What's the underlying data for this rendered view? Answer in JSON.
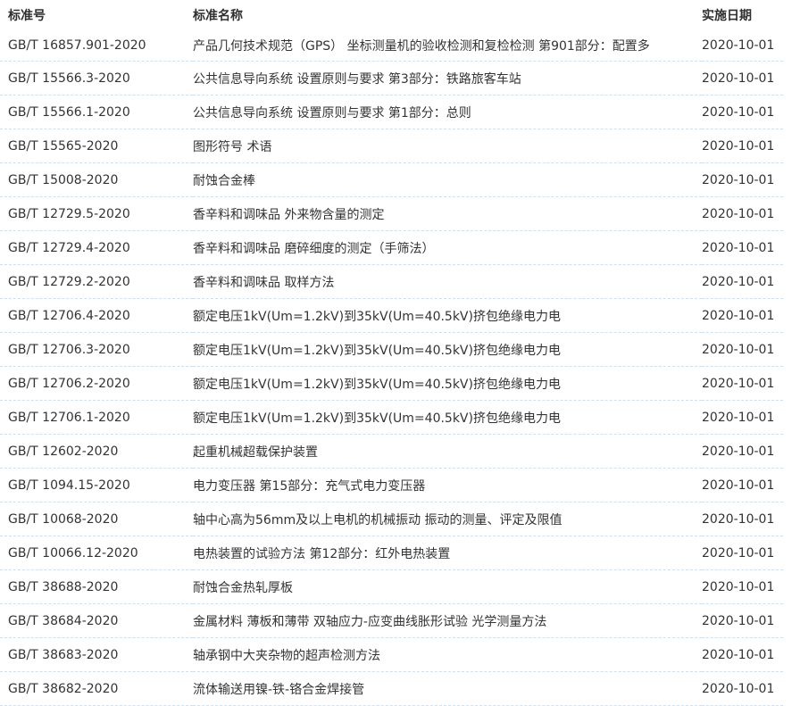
{
  "table": {
    "headers": {
      "code": "标准号",
      "name": "标准名称",
      "date": "实施日期"
    },
    "rows": [
      {
        "code": "GB/T 16857.901-2020",
        "name": "产品几何技术规范（GPS） 坐标测量机的验收检测和复检检测 第901部分：配置多",
        "date": "2020-10-01"
      },
      {
        "code": "GB/T 15566.3-2020",
        "name": "公共信息导向系统 设置原则与要求 第3部分：铁路旅客车站",
        "date": "2020-10-01"
      },
      {
        "code": "GB/T 15566.1-2020",
        "name": "公共信息导向系统 设置原则与要求 第1部分：总则",
        "date": "2020-10-01"
      },
      {
        "code": "GB/T 15565-2020",
        "name": "图形符号 术语",
        "date": "2020-10-01"
      },
      {
        "code": "GB/T 15008-2020",
        "name": "耐蚀合金棒",
        "date": "2020-10-01"
      },
      {
        "code": "GB/T 12729.5-2020",
        "name": "香辛料和调味品 外来物含量的测定",
        "date": "2020-10-01"
      },
      {
        "code": "GB/T 12729.4-2020",
        "name": "香辛料和调味品 磨碎细度的测定（手筛法）",
        "date": "2020-10-01"
      },
      {
        "code": "GB/T 12729.2-2020",
        "name": "香辛料和调味品 取样方法",
        "date": "2020-10-01"
      },
      {
        "code": "GB/T 12706.4-2020",
        "name": "额定电压1kV(Um=1.2kV)到35kV(Um=40.5kV)挤包绝缘电力电",
        "date": "2020-10-01"
      },
      {
        "code": "GB/T 12706.3-2020",
        "name": "额定电压1kV(Um=1.2kV)到35kV(Um=40.5kV)挤包绝缘电力电",
        "date": "2020-10-01"
      },
      {
        "code": "GB/T 12706.2-2020",
        "name": "额定电压1kV(Um=1.2kV)到35kV(Um=40.5kV)挤包绝缘电力电",
        "date": "2020-10-01"
      },
      {
        "code": "GB/T 12706.1-2020",
        "name": "额定电压1kV(Um=1.2kV)到35kV(Um=40.5kV)挤包绝缘电力电",
        "date": "2020-10-01"
      },
      {
        "code": "GB/T 12602-2020",
        "name": "起重机械超载保护装置",
        "date": "2020-10-01"
      },
      {
        "code": "GB/T 1094.15-2020",
        "name": "电力变压器 第15部分：充气式电力变压器",
        "date": "2020-10-01"
      },
      {
        "code": "GB/T 10068-2020",
        "name": "轴中心高为56mm及以上电机的机械振动 振动的测量、评定及限值",
        "date": "2020-10-01"
      },
      {
        "code": "GB/T 10066.12-2020",
        "name": "电热装置的试验方法 第12部分：红外电热装置",
        "date": "2020-10-01"
      },
      {
        "code": "GB/T 38688-2020",
        "name": "耐蚀合金热轧厚板",
        "date": "2020-10-01"
      },
      {
        "code": "GB/T 38684-2020",
        "name": "金属材料 薄板和薄带 双轴应力-应变曲线胀形试验 光学测量方法",
        "date": "2020-10-01"
      },
      {
        "code": "GB/T 38683-2020",
        "name": "轴承钢中大夹杂物的超声检测方法",
        "date": "2020-10-01"
      },
      {
        "code": "GB/T 38682-2020",
        "name": "流体输送用镍-铁-铬合金焊接管",
        "date": "2020-10-01"
      }
    ]
  }
}
